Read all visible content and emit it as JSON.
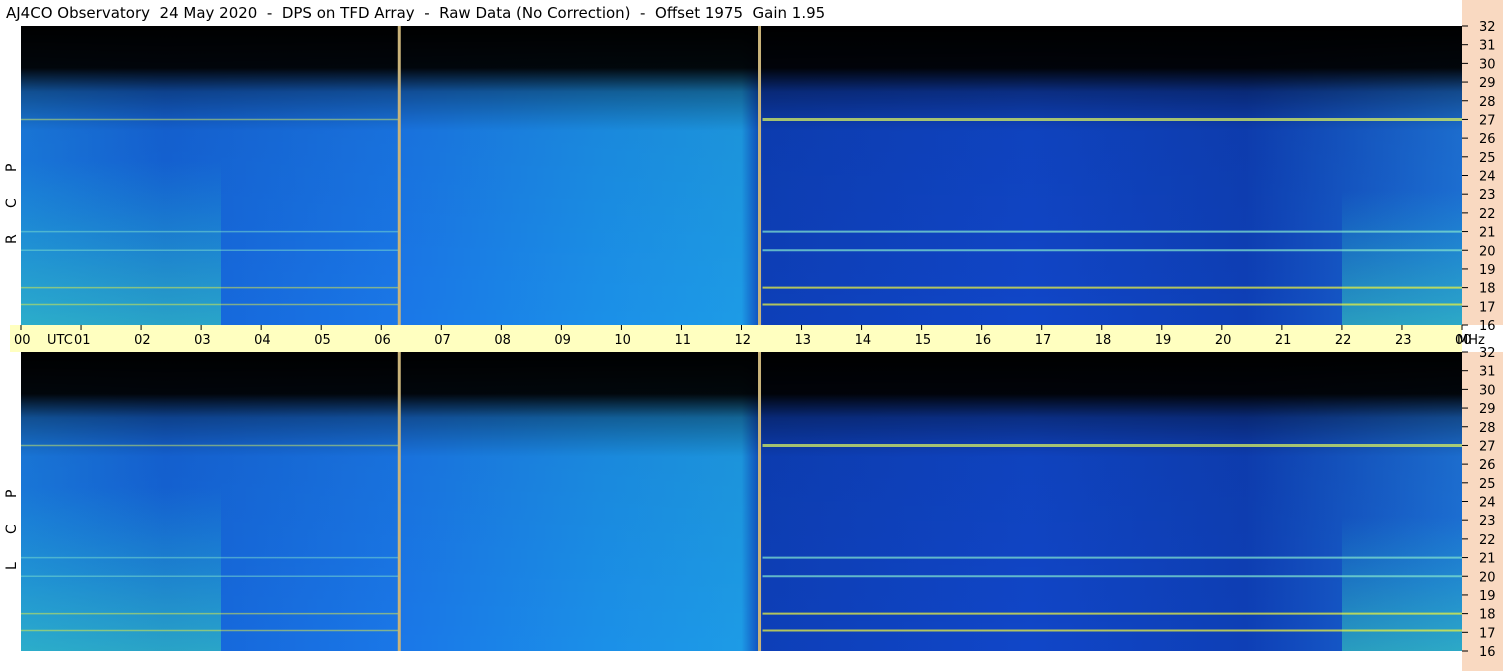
{
  "title": "AJ4CO Observatory  24 May 2020  -  DPS on TFD Array  -  Raw Data (No Correction)  -  Offset 1975  Gain 1.95",
  "colors": {
    "background": "#000000",
    "axis_band": "#ffffc0",
    "freq_band": "#f9d9c1",
    "gap_line": "#c9b37a"
  },
  "chart_data": [
    {
      "type": "heatmap",
      "panel": "R C P",
      "polarization_label": [
        "R",
        "C",
        "P"
      ],
      "x": {
        "range_utc_hours": [
          0,
          24
        ],
        "tick_labels": [
          "00",
          "UTC",
          "01",
          "02",
          "03",
          "04",
          "05",
          "06",
          "07",
          "08",
          "09",
          "10",
          "11",
          "12",
          "13",
          "14",
          "15",
          "16",
          "17",
          "18",
          "19",
          "20",
          "21",
          "22",
          "23",
          "00"
        ]
      },
      "y": {
        "unit": "MHz",
        "range": [
          16,
          32
        ],
        "ticks": [
          16,
          17,
          18,
          19,
          20,
          21,
          22,
          23,
          24,
          25,
          26,
          27,
          28,
          29,
          30,
          31,
          32
        ]
      },
      "data_gaps_utc": [
        6.3,
        12.3
      ],
      "strong_emission_bands_mhz": [
        27.0,
        18.0,
        17.1,
        21.0,
        20.0
      ]
    },
    {
      "type": "heatmap",
      "panel": "L C P",
      "polarization_label": [
        "L",
        "C",
        "P"
      ],
      "x": {
        "range_utc_hours": [
          0,
          24
        ]
      },
      "y": {
        "unit": "MHz",
        "range": [
          16,
          32
        ],
        "ticks": [
          16,
          17,
          18,
          19,
          20,
          21,
          22,
          23,
          24,
          25,
          26,
          27,
          28,
          29,
          30,
          31,
          32
        ]
      },
      "data_gaps_utc": [
        6.3,
        12.3
      ],
      "strong_emission_bands_mhz": [
        27.0,
        18.0,
        17.1,
        21.0,
        20.0
      ]
    }
  ],
  "axis": {
    "time_labels": [
      "00",
      "UTC",
      "01",
      "02",
      "03",
      "04",
      "05",
      "06",
      "07",
      "08",
      "09",
      "10",
      "11",
      "12",
      "13",
      "14",
      "15",
      "16",
      "17",
      "18",
      "19",
      "20",
      "21",
      "22",
      "23",
      "00",
      "MHz"
    ],
    "freq_labels": [
      "32",
      "31",
      "30",
      "29",
      "28",
      "27",
      "26",
      "25",
      "24",
      "23",
      "22",
      "21",
      "20",
      "19",
      "18",
      "17",
      "16"
    ]
  }
}
